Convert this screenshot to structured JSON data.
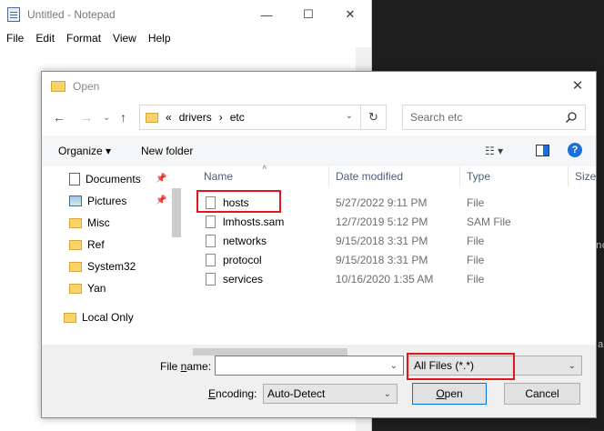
{
  "notepad": {
    "title": "Untitled - Notepad",
    "menu": [
      "File",
      "Edit",
      "Format",
      "View",
      "Help"
    ],
    "minimize": "—",
    "maximize": "☐",
    "close": "✕"
  },
  "dialog": {
    "title": "Open",
    "close": "✕",
    "nav": {
      "back": "←",
      "forward": "→",
      "up": "↑",
      "recent": "⌄"
    },
    "address": {
      "chevrons": "«",
      "path1": "drivers",
      "sep": "›",
      "path2": "etc",
      "dropdown": "⌄",
      "refresh": "↻"
    },
    "search_placeholder": "Search etc",
    "toolbar": {
      "organize": "Organize ▾",
      "new_folder": "New folder",
      "view": "☷ ▾",
      "help": "?"
    },
    "nav_items": [
      {
        "label": "Documents"
      },
      {
        "label": "Pictures"
      },
      {
        "label": "Misc"
      },
      {
        "label": "Ref"
      },
      {
        "label": "System32"
      },
      {
        "label": "Yan"
      },
      {
        "label": "Local Only"
      }
    ],
    "columns": {
      "name": "Name",
      "date": "Date modified",
      "type": "Type",
      "size": "Size"
    },
    "files": [
      {
        "name": "hosts",
        "date": "5/27/2022 9:11 PM",
        "type": "File"
      },
      {
        "name": "lmhosts.sam",
        "date": "12/7/2019 5:12 PM",
        "type": "SAM File"
      },
      {
        "name": "networks",
        "date": "9/15/2018 3:31 PM",
        "type": "File"
      },
      {
        "name": "protocol",
        "date": "9/15/2018 3:31 PM",
        "type": "File"
      },
      {
        "name": "services",
        "date": "10/16/2020 1:35 AM",
        "type": "File"
      }
    ],
    "file_name_label_pre": "File ",
    "file_name_label_u": "n",
    "file_name_label_post": "ame:",
    "file_name_value": "",
    "filter": "All Files  (*.*)",
    "encoding_label_u": "E",
    "encoding_label_post": "ncoding:",
    "encoding_value": "Auto-Detect",
    "open_u": "O",
    "open_post": "pen",
    "cancel": "Cancel"
  },
  "background_text": {
    "a": "nc",
    "b": "a"
  },
  "colors": {
    "highlight": "#e0161c",
    "accent": "#0078d7",
    "folder": "#f6d36b"
  }
}
